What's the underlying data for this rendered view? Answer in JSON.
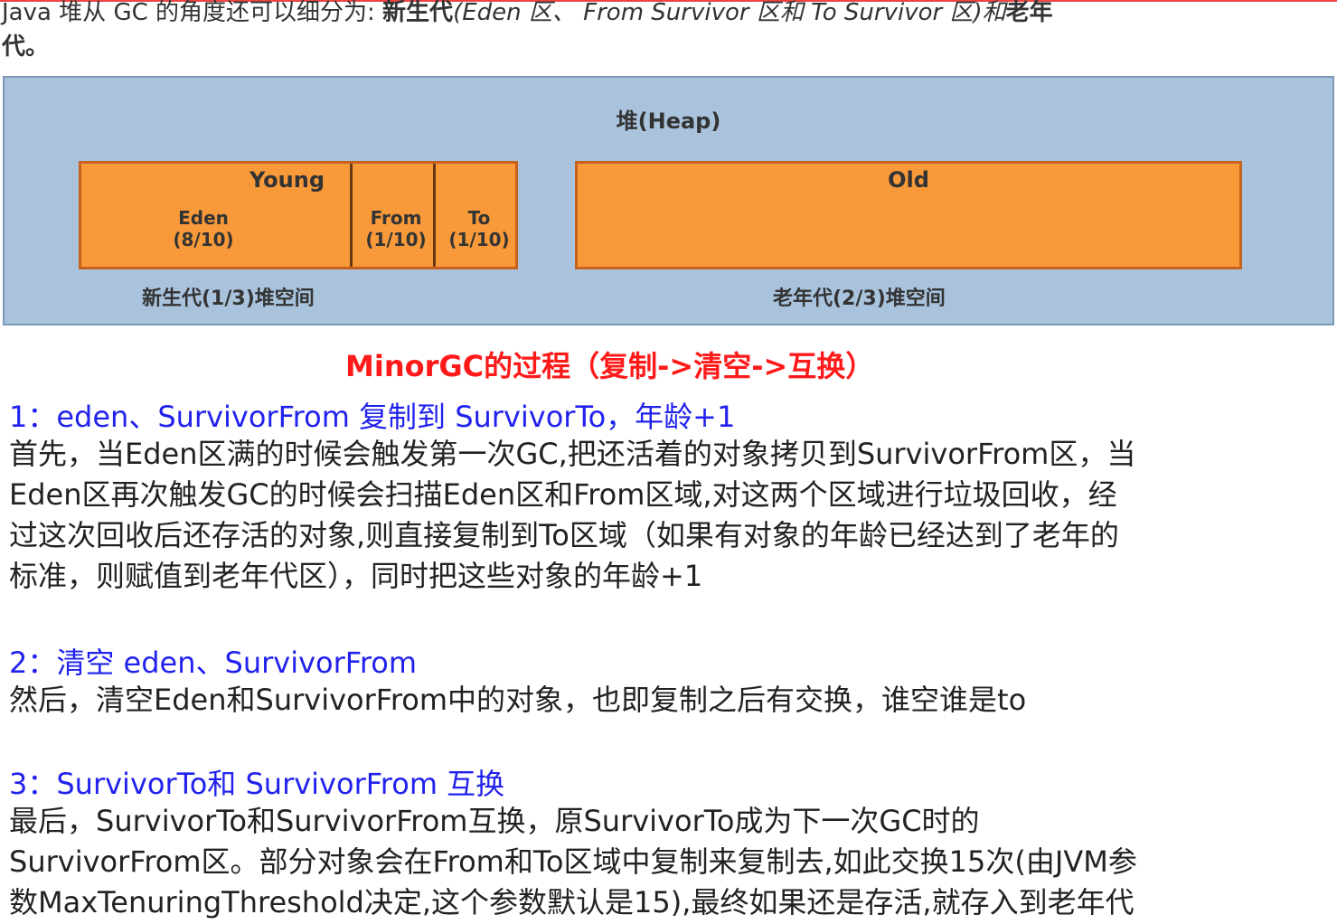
{
  "intro": {
    "line1_prefix": "Java 堆从 GC 的角度还可以细分为: ",
    "line1_bold": "新生代",
    "line1_paren": "(Eden 区、 From Survivor 区和 To Survivor 区)和",
    "line1_bold2": "老年",
    "line2": "代。"
  },
  "heap": {
    "title": "堆(Heap)",
    "young": {
      "title": "Young",
      "eden": "Eden",
      "eden_ratio": "(8/10)",
      "from": "From",
      "from_ratio": "(1/10)",
      "to": "To",
      "to_ratio": "(1/10)",
      "caption": "新生代(1/3)堆空间"
    },
    "old": {
      "title": "Old",
      "caption": "老年代(2/3)堆空间"
    }
  },
  "minor_title": "MinorGC的过程（复制->清空->互换）",
  "steps": [
    {
      "heading": "1：eden、SurvivorFrom 复制到 SurvivorTo，年龄+1",
      "lines": [
        "首先，当Eden区满的时候会触发第一次GC,把还活着的对象拷贝到SurvivorFrom区，当",
        "Eden区再次触发GC的时候会扫描Eden区和From区域,对这两个区域进行垃圾回收，经",
        "过这次回收后还存活的对象,则直接复制到To区域（如果有对象的年龄已经达到了老年的",
        "标准，则赋值到老年代区），同时把这些对象的年龄+1"
      ]
    },
    {
      "heading": "2：清空 eden、SurvivorFrom",
      "lines": [
        "然后，清空Eden和SurvivorFrom中的对象，也即复制之后有交换，谁空谁是to"
      ]
    },
    {
      "heading": "3：SurvivorTo和 SurvivorFrom 互换",
      "lines": [
        "最后，SurvivorTo和SurvivorFrom互换，原SurvivorTo成为下一次GC时的",
        "SurvivorFrom区。部分对象会在From和To区域中复制来复制去,如此交换15次(由JVM参",
        "数MaxTenuringThreshold决定,这个参数默认是15),最终如果还是存活,就存入到老年代"
      ]
    }
  ],
  "colors": {
    "heap_bg": "#a9c3dd",
    "region": "#f89a3a",
    "minor_title": "#ff1a1a",
    "step_heading": "#2222ee"
  }
}
